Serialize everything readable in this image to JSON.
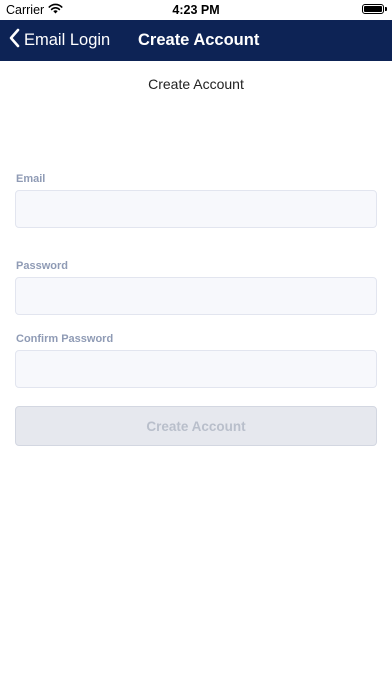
{
  "status_bar": {
    "carrier": "Carrier",
    "time": "4:23 PM"
  },
  "nav": {
    "back_label": "Email Login",
    "title": "Create Account",
    "background": "#0d2355"
  },
  "page": {
    "heading": "Create Account"
  },
  "form": {
    "email_label": "Email",
    "email_value": "",
    "password_label": "Password",
    "password_value": "",
    "confirm_label": "Confirm Password",
    "confirm_value": "",
    "submit_label": "Create Account"
  },
  "icons": {
    "wifi": "wifi-icon",
    "battery": "battery-icon",
    "back": "chevron-left-icon"
  }
}
